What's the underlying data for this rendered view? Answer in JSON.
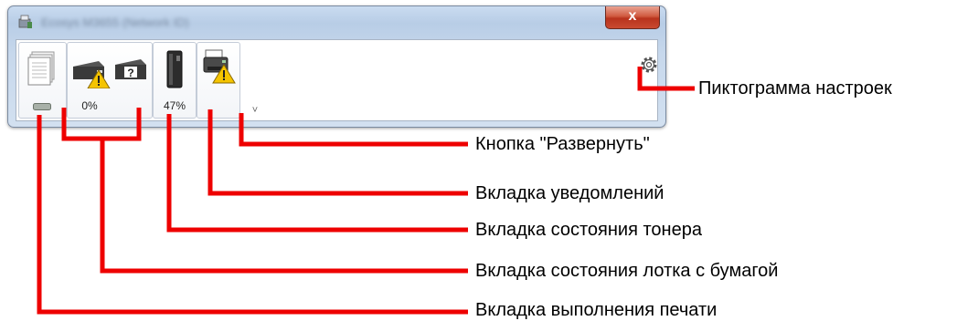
{
  "window": {
    "title": "Ecosys M3655 (Network ID)",
    "close_glyph": "x"
  },
  "tabs": {
    "print_progress": {
      "icon": "print-queue-icon"
    },
    "paper_tray": {
      "percent": "0%",
      "icon": "paper-tray-warning-icon"
    },
    "toner": {
      "percent": "47%",
      "icon": "toner-cartridge-icon"
    },
    "notification": {
      "icon": "printer-warning-icon"
    }
  },
  "expand_glyph": "˅",
  "callouts": {
    "settings_icon": "Пиктограмма настроек",
    "expand_button": "Кнопка \"Развернуть\"",
    "notification_tab": "Вкладка уведомлений",
    "toner_tab": "Вкладка состояния тонера",
    "paper_tray_tab": "Вкладка состояния лотка с бумагой",
    "print_progress_tab": "Вкладка выполнения печати"
  },
  "colors": {
    "callout_line": "#ee0000",
    "warning": "#f5c400",
    "close_button": "#c94a30"
  }
}
